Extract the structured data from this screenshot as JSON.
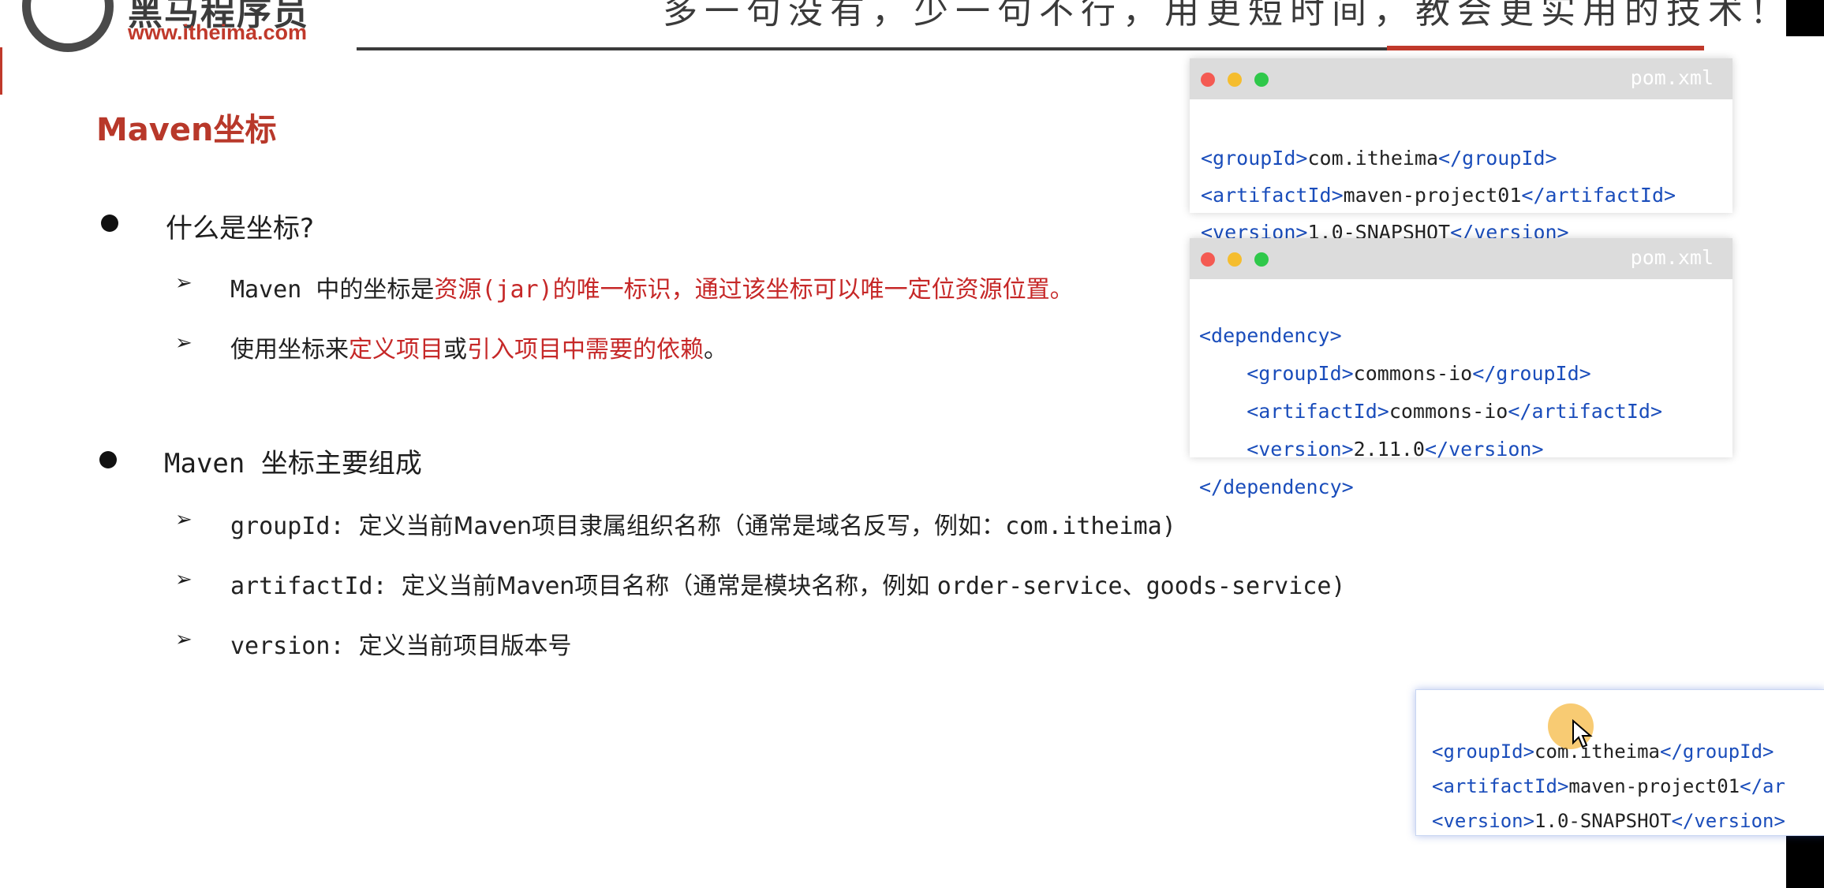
{
  "header": {
    "logo_mark": "𝓀",
    "brand_name": "黑马程序员",
    "brand_url": "www.itheima.com",
    "slogan": "多一句没有，少一句不行，用更短时间，教会更实用的技术！"
  },
  "slide": {
    "title": "Maven坐标",
    "section1": {
      "heading": "什么是坐标?",
      "items": [
        {
          "parts": [
            "Maven 中的坐标是",
            "资源(jar)的唯一标识，通过该坐标可以唯一定位资源位置。"
          ]
        },
        {
          "parts": [
            "使用坐标来",
            "定义项目",
            "或",
            "引入项目中需要的依赖",
            "。"
          ]
        }
      ]
    },
    "section2": {
      "heading": "Maven 坐标主要组成",
      "items": [
        {
          "key": "groupId",
          "colon": ": ",
          "desc": "定义当前Maven项目隶属组织名称（通常是域名反写，例如：",
          "example": "com.itheima)"
        },
        {
          "key": "artifactId",
          "colon": ": ",
          "desc": "定义当前Maven项目名称（通常是模块名称，例如 ",
          "example": "order-service、goods-service)"
        },
        {
          "key": "version",
          "colon": ": ",
          "desc": "定义当前项目版本号",
          "example": ""
        }
      ]
    }
  },
  "cards": [
    {
      "filename": "pom.xml",
      "lines": [
        [
          "<groupId>",
          "com.itheima",
          "</groupId>"
        ],
        [
          "<artifactId>",
          "maven-project01",
          "</artifactId>"
        ],
        [
          "<version>",
          "1.0-SNAPSHOT",
          "</version>"
        ]
      ]
    },
    {
      "filename": "pom.xml",
      "lines": [
        [
          "<dependency>",
          "",
          ""
        ],
        [
          "    <groupId>",
          "commons-io",
          "</groupId>"
        ],
        [
          "    <artifactId>",
          "commons-io",
          "</artifactId>"
        ],
        [
          "    <version>",
          "2.11.0",
          "</version>"
        ],
        [
          "</dependency>",
          "",
          ""
        ]
      ]
    },
    {
      "lines": [
        [
          "<groupId>",
          "com.itheima",
          "</groupId>"
        ],
        [
          "<artifactId>",
          "maven-project01",
          "</ar"
        ],
        [
          "<version>",
          "1.0-SNAPSHOT",
          "</version>"
        ]
      ]
    }
  ],
  "colors": {
    "accent_red": "#c62828",
    "title_red": "#b8382a",
    "xml_tag_blue": "#1a4dbb"
  }
}
